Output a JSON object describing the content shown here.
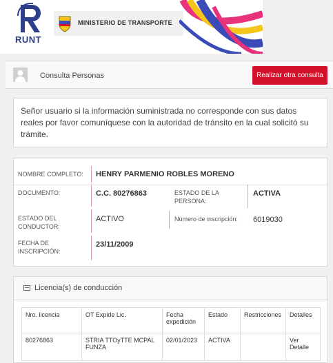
{
  "header": {
    "runt_label": "RUNT",
    "ministerio_label": "MINISTERIO DE TRANSPORTE",
    "colors": {
      "runt_blue": "#2d3e8c",
      "stripe_pink": "#e8327c",
      "stripe_yellow": "#f5c518",
      "stripe_blue": "#3a4bb8"
    }
  },
  "topbar": {
    "title": "Consulta Personas",
    "button_label": "Realizar otra consulta",
    "button_color": "#d3132a",
    "icon": "user-icon"
  },
  "notice": {
    "text": "Señor usuario si la información suministrada no corresponde con sus datos reales por favor comuníquese con la autoridad de tránsito en la cual solicitó su trámite."
  },
  "person": {
    "nombre_label": "NOMBRE COMPLETO:",
    "nombre_value": "HENRY PARMENIO ROBLES MORENO",
    "documento_label": "DOCUMENTO:",
    "documento_value": "C.C. 80276863",
    "estado_persona_label_1": "ESTADO DE LA",
    "estado_persona_label_2": "PERSONA:",
    "estado_persona_value": "ACTIVA",
    "estado_conductor_label_1": "ESTADO DEL",
    "estado_conductor_label_2": "CONDUCTOR:",
    "estado_conductor_value": "ACTIVO",
    "inscripcion_num_label": "Número de inscripción:",
    "inscripcion_num_value": "6019030",
    "fecha_label_1": "FECHA DE",
    "fecha_label_2": "INSCRIPCIÓN:",
    "fecha_value": "23/11/2009"
  },
  "license": {
    "title": "Licencia(s) de conducción",
    "icon": "id-card-icon",
    "headers": [
      "Nro. licencia",
      "OT Expide Lic.",
      "Fecha expedición",
      "Estado",
      "Restricciones",
      "Detalles"
    ],
    "rows": [
      [
        "80276863",
        "STRIA TTOyTTE MCPAL FUNZA",
        "02/01/2023",
        "ACTIVA",
        "",
        "Ver Detalle"
      ]
    ]
  }
}
